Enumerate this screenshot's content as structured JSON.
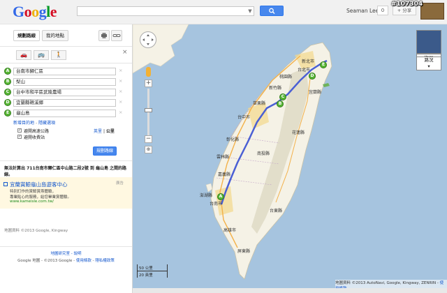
{
  "header": {
    "logo": "Google",
    "user_name": "Seaman Lee",
    "notifications": "0",
    "share": "+ 分享",
    "image_id": "#107304"
  },
  "panel": {
    "tabs": [
      {
        "label": "規劃路線"
      },
      {
        "label": "我的地點"
      }
    ],
    "travel_modes": [
      "car-icon",
      "transit-icon",
      "walk-icon"
    ],
    "waypoints": [
      {
        "letter": "A",
        "value": "台南市歸仁區"
      },
      {
        "letter": "B",
        "value": "梨山"
      },
      {
        "letter": "C",
        "value": "台中市和平區武陵農場"
      },
      {
        "letter": "D",
        "value": "宜蘭縣礁溪鄉"
      },
      {
        "letter": "E",
        "value": "龜山島"
      }
    ],
    "add_destination": "新增目的地",
    "hide_options": "隱藏選項",
    "option_avoid_highways": "避開高速公路",
    "option_avoid_tolls": "避開收費站",
    "unit_imperial": "英里",
    "unit_metric": "公里",
    "plan_button": "規劃路線",
    "result_text": "無法計算出 711台南市歸仁區中山路二段2號 到 龜山島 之間的路線。",
    "ad": {
      "tag": "廣告",
      "title": "宜蘭賞鯨龜山島遊客中心",
      "line1": "特別訂作的賞鯨賞燕體驗，",
      "line2": "專業貼心的服務，給您畢業賞體驗。",
      "url": "www.kameisle.com.tw/"
    },
    "map_data_credit": "地圖資料 ©2013 Google, Kingway",
    "footer_links": "地圖研究室 - 說明",
    "footer_copyright": "Google 地圖 - ©2013 Google - ",
    "footer_terms": "使用條款",
    "footer_privacy": "隱私權政策"
  },
  "map": {
    "view_satellite": "衛星",
    "view_traffic": "路況",
    "scale_metric": "50 公里",
    "scale_imperial": "20 英里",
    "attribution": "地圖資料 ©2013 AutoNavi, Google, Kingway, ZENRIN -",
    "terms": "使用條款",
    "markers": [
      "A",
      "B",
      "C",
      "D",
      "E"
    ],
    "labels": [
      "新北市",
      "台北市",
      "桃園縣",
      "新竹縣",
      "苗栗縣",
      "台中市",
      "南投縣",
      "彰化縣",
      "雲林縣",
      "嘉義縣",
      "台南市",
      "高雄市",
      "屏東縣",
      "花蓮縣",
      "台東縣",
      "宜蘭縣",
      "澎湖縣"
    ]
  },
  "colors": {
    "route": "#4a5fd4",
    "land": "#f5f2e6",
    "water": "#a6c4df",
    "marker": "#58b536"
  }
}
